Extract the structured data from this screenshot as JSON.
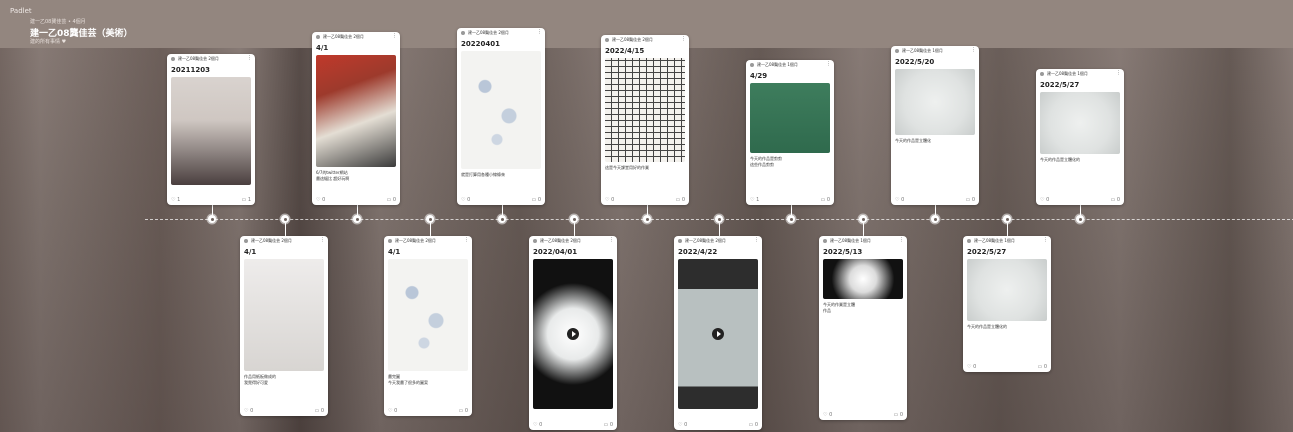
{
  "app_name": "Padlet",
  "board": {
    "breadcrumb": "建一乙08龔佳芸 • 4個月",
    "title": "建一乙08龔佳芸（美術）",
    "subtitle": "建的所有事情 ♥"
  },
  "posts": [
    {
      "author": "建一乙08龔佳芸",
      "age": "2個月",
      "title": "20211203",
      "text": "",
      "likes": "1",
      "comments": "1"
    },
    {
      "author": "建一乙08龔佳芸",
      "age": "2個月",
      "title": "4/1",
      "text": "6/7的twitter網站\n畫這幅比 超好玩啊",
      "likes": "0",
      "comments": "0"
    },
    {
      "author": "建一乙08龔佳芸",
      "age": "2個月",
      "title": "20220401",
      "text": "就是打算用各種小線條來",
      "likes": "0",
      "comments": "0"
    },
    {
      "author": "建一乙08龔佳芸",
      "age": "2個月",
      "title": "2022/4/15",
      "text": "這是今天課堂用好的作業",
      "likes": "0",
      "comments": "0"
    },
    {
      "author": "建一乙08龔佳芸",
      "age": "1個月",
      "title": "4/29",
      "text": "今天的作品是剪剪\n這些作品剪剪",
      "likes": "1",
      "comments": "0"
    },
    {
      "author": "建一乙08龔佳芸",
      "age": "1個月",
      "title": "2022/5/20",
      "text": "今天的作品是立體化",
      "likes": "0",
      "comments": "0"
    },
    {
      "author": "建一乙08龔佳芸",
      "age": "1個月",
      "title": "2022/5/27",
      "text": "今天的作品是立體化的",
      "likes": "0",
      "comments": "0"
    },
    {
      "author": "建一乙08龔佳芸",
      "age": "2個月",
      "title": "4/1",
      "text": "作品用紙板做成的\n我覺得好可愛",
      "likes": "0",
      "comments": "0"
    },
    {
      "author": "建一乙08龔佳芸",
      "age": "2個月",
      "title": "4/1",
      "text": "畫完圖\n今天我畫了很多的圖案",
      "likes": "0",
      "comments": "0"
    },
    {
      "author": "建一乙08龔佳芸",
      "age": "2個月",
      "title": "2022/04/01",
      "text": "",
      "likes": "0",
      "comments": "0"
    },
    {
      "author": "建一乙08龔佳芸",
      "age": "2個月",
      "title": "2022/4/22",
      "text": "",
      "likes": "0",
      "comments": "0"
    },
    {
      "author": "建一乙08龔佳芸",
      "age": "1個月",
      "title": "2022/5/13",
      "text": "今天的作業是立體\n作品",
      "likes": "0",
      "comments": "0"
    },
    {
      "author": "建一乙08龔佳芸",
      "age": "1個月",
      "title": "2022/5/27",
      "text": "今天的作品是立體化的",
      "likes": "0",
      "comments": "0"
    }
  ]
}
